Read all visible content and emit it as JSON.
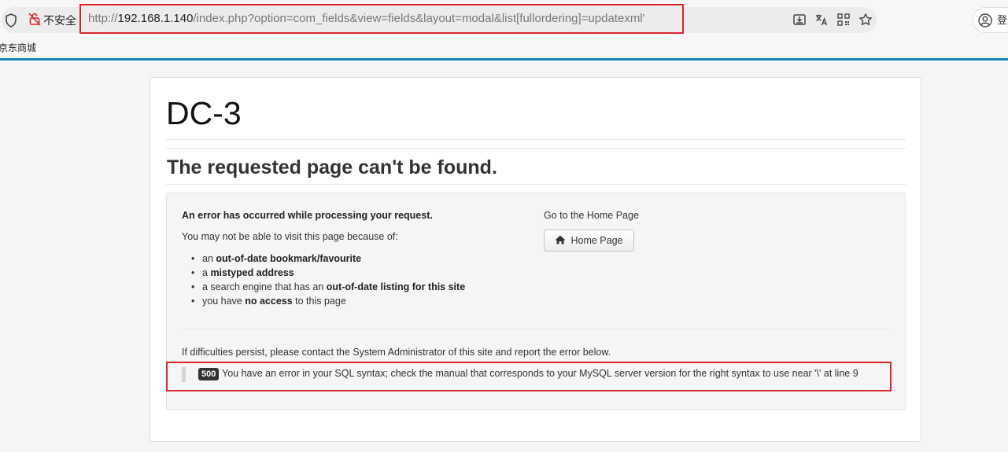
{
  "browser": {
    "security_label": "不安全",
    "url_prefix": "http://",
    "url_host": "192.168.1.140",
    "url_path": "/index.php?option=com_fields&view=fields&layout=modal&list[fullordering]=updatexml'",
    "profile_label": "登录",
    "bookmark": "京东商城",
    "accent_color": "#1a7fc0",
    "highlight_color": "#d9262e"
  },
  "page": {
    "site_title": "DC-3",
    "heading": "The requested page can't be found.",
    "error_title": "An error has occurred while processing your request.",
    "intro": "You may not be able to visit this page because of:",
    "reasons": [
      {
        "pre": "an ",
        "bold": "out-of-date bookmark/favourite",
        "post": ""
      },
      {
        "pre": "a ",
        "bold": "mistyped address",
        "post": ""
      },
      {
        "pre": "a search engine that has an ",
        "bold": "out-of-date listing for this site",
        "post": ""
      },
      {
        "pre": "you have ",
        "bold": "no access",
        "post": " to this page"
      }
    ],
    "home_prompt": "Go to the Home Page",
    "home_button": "Home Page",
    "contact": "If difficulties persist, please contact the System Administrator of this site and report the error below.",
    "error_code": "500",
    "error_message": "You have an error in your SQL syntax; check the manual that corresponds to your MySQL server version for the right syntax to use near '\\' at line 9"
  }
}
